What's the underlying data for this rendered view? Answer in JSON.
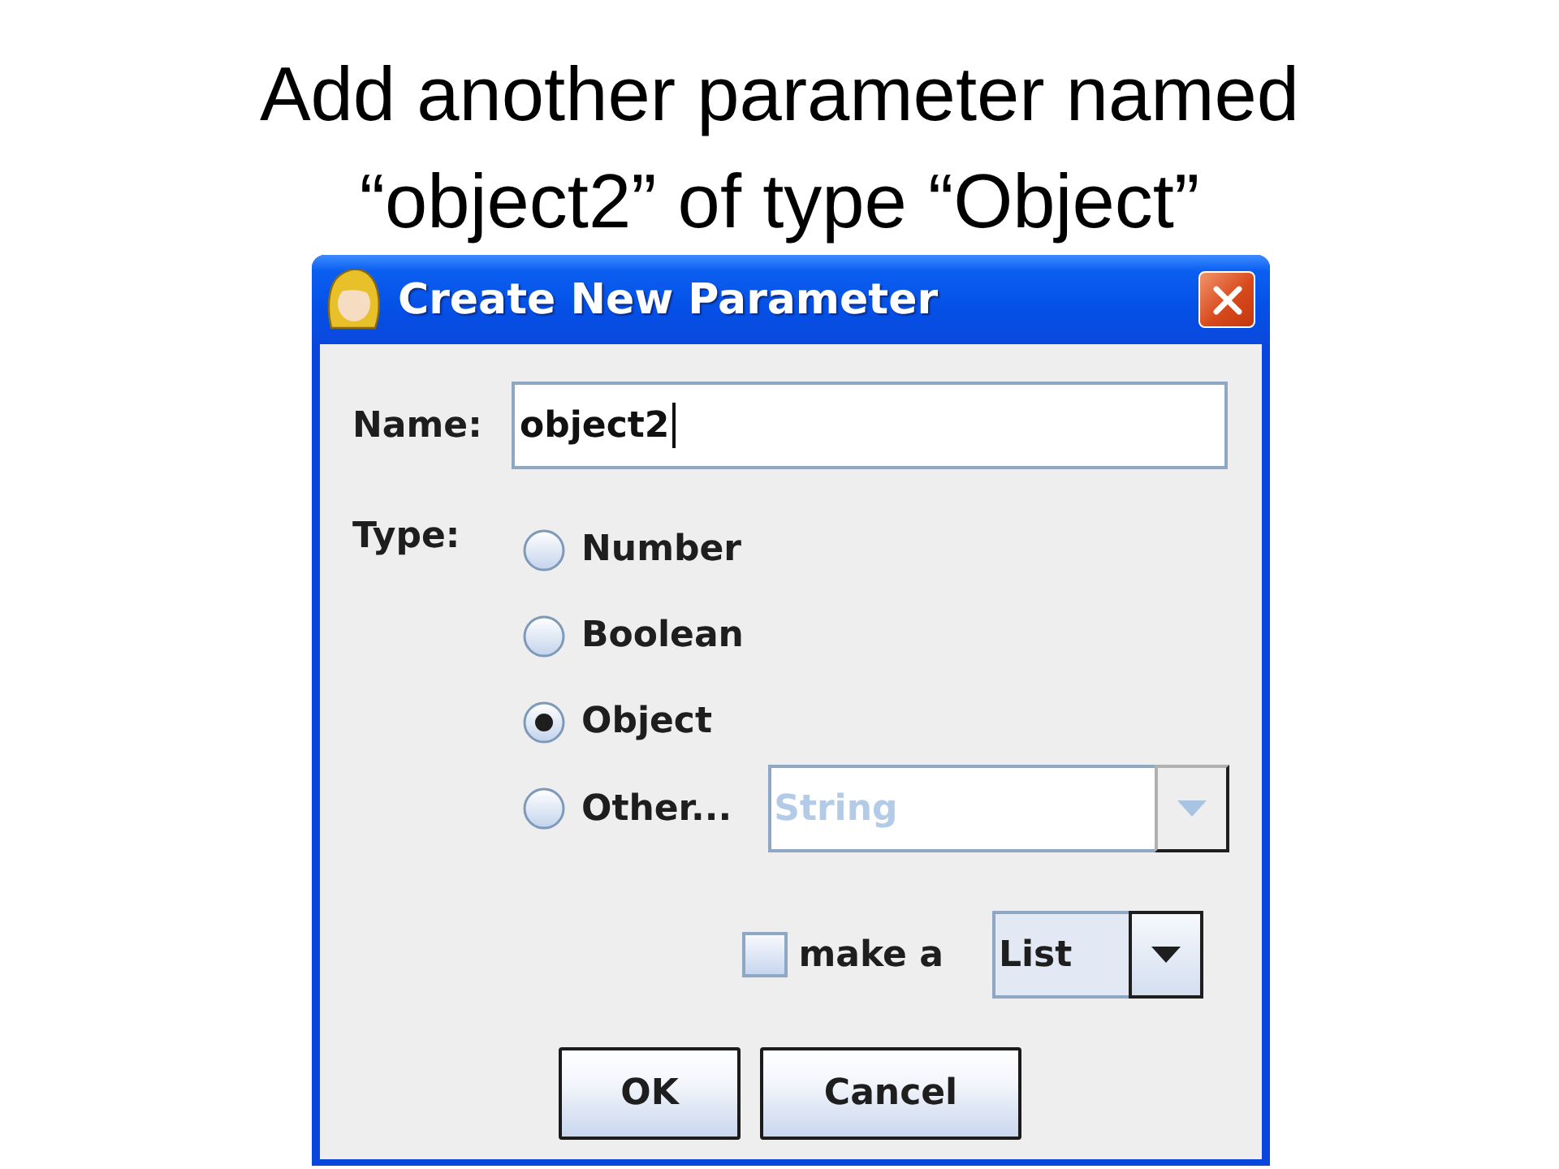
{
  "slide_title": "Add another parameter named\n“object2” of type “Object”",
  "dialog": {
    "title": "Create New Parameter",
    "name_label": "Name:",
    "name_field": {
      "value": "object2",
      "focused": true
    },
    "type_label": "Type:",
    "type_options": [
      {
        "label": "Number",
        "selected": false
      },
      {
        "label": "Boolean",
        "selected": false
      },
      {
        "label": "Object",
        "selected": true
      },
      {
        "label": "Other...",
        "selected": false,
        "dropdown": {
          "value": "String",
          "disabled": true
        }
      }
    ],
    "make_list": {
      "label": "make a",
      "checked": false
    },
    "collection_dropdown": {
      "value": "List",
      "disabled": false
    },
    "buttons": [
      "OK",
      "Cancel"
    ]
  }
}
